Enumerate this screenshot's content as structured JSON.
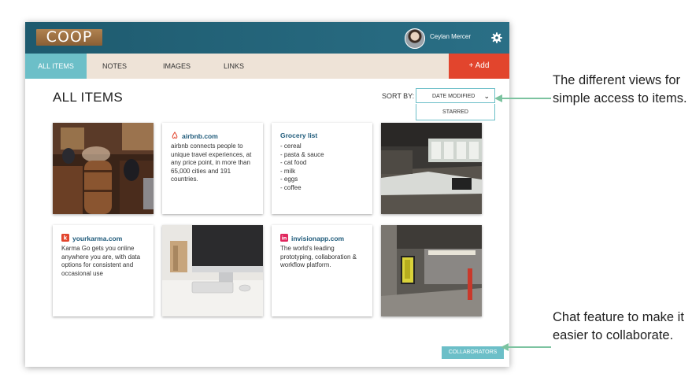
{
  "app": {
    "logo_text": "COOP"
  },
  "user": {
    "name": "Ceylan Mercer"
  },
  "nav": {
    "tabs": [
      {
        "label": "ALL ITEMS"
      },
      {
        "label": "NOTES"
      },
      {
        "label": "IMAGES"
      },
      {
        "label": "LINKS"
      }
    ],
    "add_label": "+ Add"
  },
  "main": {
    "heading": "ALL ITEMS",
    "sort_label": "SORT BY:",
    "sort_selected": "DATE MODIFIED",
    "sort_options": [
      "STARRED"
    ]
  },
  "cards": {
    "airbnb": {
      "title": "airbnb.com",
      "text": "airbnb connects people to unique travel experiences, at any price point, in more than 65,000 cities and 191 countries."
    },
    "grocery": {
      "title": "Grocery list",
      "items": [
        "- cereal",
        "- pasta & sauce",
        "- cat food",
        "- milk",
        "- eggs",
        "- coffee"
      ]
    },
    "karma": {
      "title": "yourkarma.com",
      "text": "Karma Go gets you online anywhere you are, with data options for consistent and occasional use"
    },
    "invision": {
      "title": "invisionapp.com",
      "text": "The world's leading prototyping, collaboration & workflow platform."
    }
  },
  "collaborators_label": "COLLABORATORS",
  "annotations": {
    "views": "The different views for simple access to items.",
    "chat": "Chat feature to make it easier to collaborate."
  },
  "colors": {
    "topbar": "#1e5a6e",
    "teal_accent": "#6cbfc8",
    "add_button": "#e2452d",
    "navbar": "#eee3d7",
    "arrow": "#7cc3a0"
  }
}
